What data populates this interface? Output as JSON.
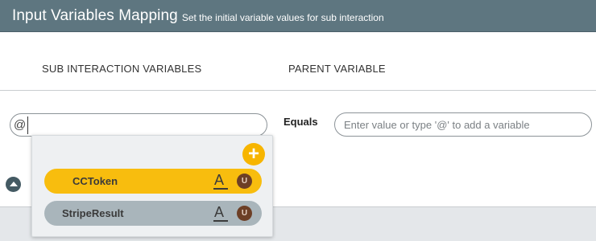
{
  "header": {
    "title": "Input Variables Mapping",
    "subtitle": "Set the initial variable values for sub interaction"
  },
  "columns": {
    "sub": "SUB INTERACTION VARIABLES",
    "parent": "PARENT VARIABLE"
  },
  "mapping": {
    "sub_input_value": "@",
    "operator": "Equals",
    "parent_placeholder": "Enter value or type '@' to add a variable"
  },
  "dropdown": {
    "add_label": "+",
    "items": [
      {
        "label": "CCToken",
        "type_glyph": "A",
        "badge": "U",
        "state": "highlighted"
      },
      {
        "label": "StripeResult",
        "type_glyph": "A",
        "badge": "U",
        "state": "normal"
      }
    ]
  },
  "colors": {
    "header_bg": "#5e7680",
    "accent": "#f7b500",
    "item_inactive": "#a9b5bb",
    "badge": "#6d3f26"
  }
}
